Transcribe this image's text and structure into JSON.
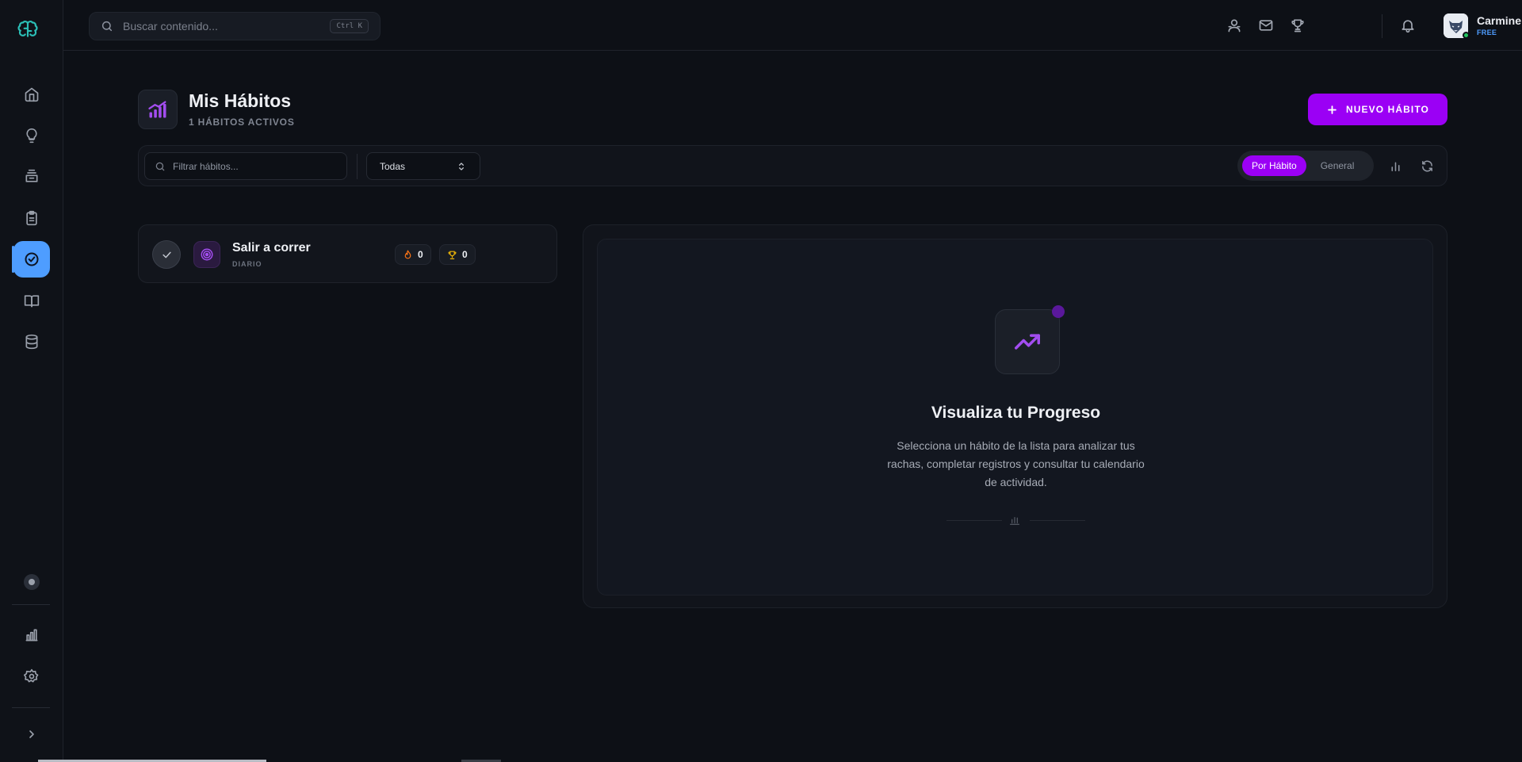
{
  "topbar": {
    "search_placeholder": "Buscar contenido...",
    "search_shortcut": "Ctrl K",
    "user": {
      "name": "Carmine Bern...",
      "plan": "FREE"
    }
  },
  "sidebar": {
    "items": [
      "home",
      "ideas",
      "inbox",
      "clipboard",
      "habits",
      "book",
      "database"
    ],
    "active": "habits",
    "bottom_items": [
      "stats",
      "settings",
      "expand"
    ]
  },
  "header": {
    "title": "Mis Hábitos",
    "subtitle": "1 HÁBITOS ACTIVOS",
    "new_button": "NUEVO HÁBITO"
  },
  "filters": {
    "search_placeholder": "Filtrar hábitos...",
    "category_selected": "Todas",
    "view_toggle": [
      {
        "label": "Por Hábito",
        "active": true
      },
      {
        "label": "General",
        "active": false
      }
    ]
  },
  "habits": [
    {
      "name": "Salir a correr",
      "frequency": "DIARIO",
      "streak": "0",
      "best": "0"
    }
  ],
  "empty_state": {
    "title": "Visualiza tu Progreso",
    "description": "Selecciona un hábito de la lista para analizar tus rachas, completar registros y consultar tu calendario de actividad."
  },
  "colors": {
    "accent": "#9b00f5",
    "active_nav": "#4e9dff",
    "background": "#0d1016",
    "streak": "#f97316",
    "trophy": "#eab308"
  }
}
